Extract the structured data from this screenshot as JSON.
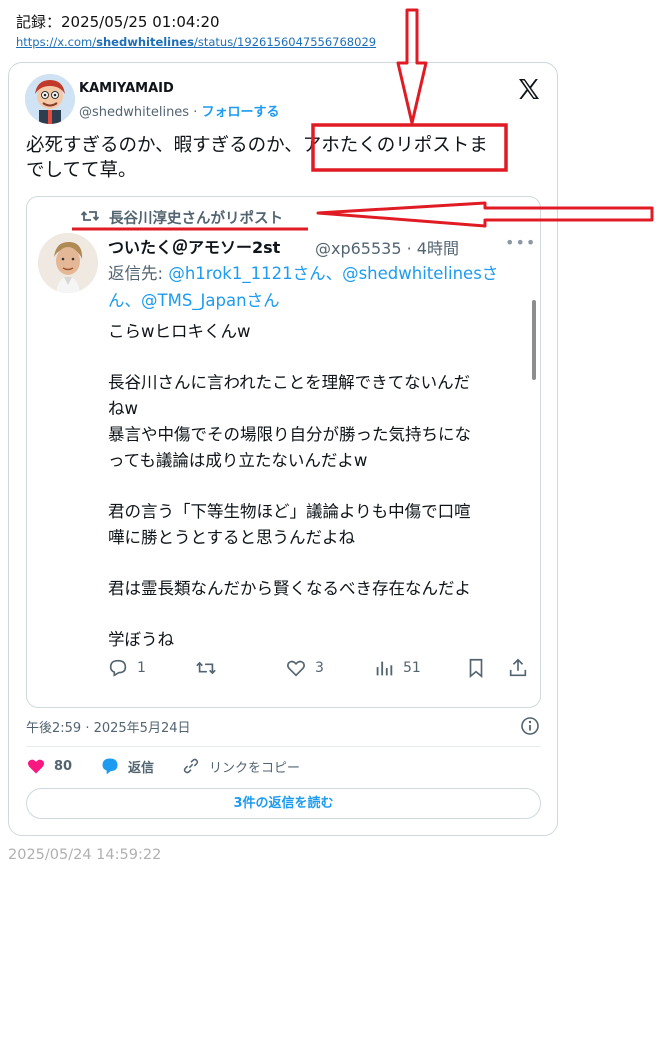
{
  "header": {
    "record_label": "記録：2025/05/25 01:04:20",
    "url_prefix": "https://x.com/",
    "url_user": "shedwhitelines",
    "url_suffix": "/status/1926156047556768029"
  },
  "tweet": {
    "author_name": "KAMIYAMAID",
    "author_handle": "@shedwhitelines",
    "separator": "·",
    "follow_label": "フォローする",
    "text_line1": "必死すぎるのか、暇すぎるのか、アホたくのリポストま",
    "text_line2": "でしてて草。",
    "timestamp": "午後2:59 · 2025年5月24日",
    "likes": "80",
    "reply_label": "返信",
    "copy_link_label": "リンクをコピー",
    "read_replies_label": "3件の返信を読む"
  },
  "quoted": {
    "repost_label": "長谷川淳史さんがリポスト",
    "name": "ついたく＠アモソー2st",
    "handle_time": "@xp65535 · 4時間",
    "more": "•••",
    "reply_to_prefix": "返信先: ",
    "mention1": "@h1rok1_1121",
    "mention_sep1": "さん、",
    "mention2": "@shedwhitelines",
    "mention_sep2": "さ",
    "reply_to_line2_prefix": "ん、",
    "mention3": "@TMS_Japan",
    "mention_sep3": "さん",
    "line1": "こらwヒロキくんw",
    "line2": "長谷川さんに言われたことを理解できてないんだ",
    "line3": "ねw",
    "line4": "暴言や中傷でその場限り自分が勝った気持ちにな",
    "line5": "っても議論は成り立たないんだよw",
    "line6": "君の言う「下等生物ほど」議論よりも中傷で口喧",
    "line7": "嘩に勝とうとすると思うんだよね",
    "line8": "君は霊長類なんだから賢くなるべき存在なんだよ",
    "line9": "学ぼうね",
    "replies": "1",
    "reposts": "",
    "likes": "3",
    "views": "51"
  },
  "footer": {
    "time": "2025/05/24 14:59:22"
  },
  "colors": {
    "accent": "#1d9bf0",
    "annotation": "#e01b24",
    "heart": "#f91880"
  }
}
